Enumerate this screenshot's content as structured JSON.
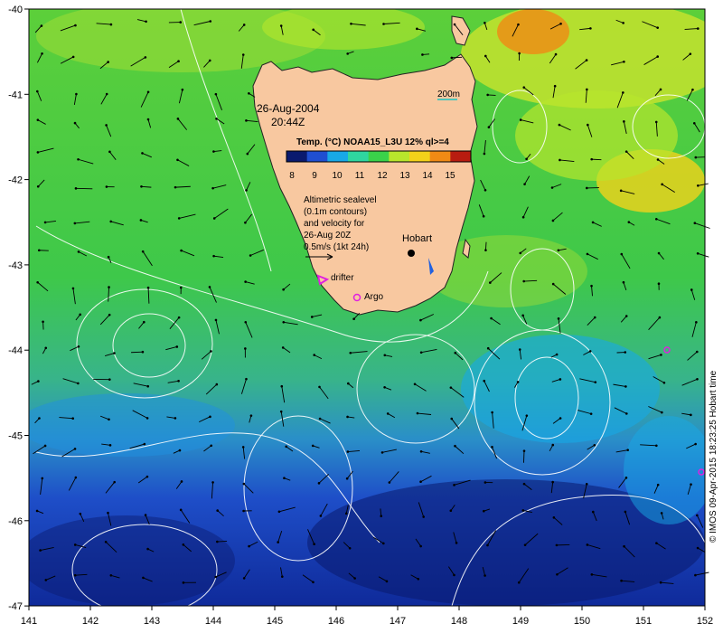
{
  "map": {
    "date": "26-Aug-2004",
    "time": "20:44Z",
    "isobath_label": "200m",
    "colorbar": {
      "title": "Temp. (°C) NOAA15_L3U 12% ql>=4",
      "ticks": [
        "8",
        "9",
        "10",
        "11",
        "12",
        "13",
        "14",
        "15"
      ],
      "colors": [
        "#0a1a6e",
        "#1f4fd1",
        "#18a9e6",
        "#2fd6a0",
        "#3ad24a",
        "#b8e62c",
        "#f3d21a",
        "#f08a14",
        "#b81c10"
      ]
    },
    "legend_lines": [
      "Altimetric sealevel",
      "(0.1m contours)",
      "and velocity for",
      "26-Aug 20Z",
      "0.5m/s (1kt 24h)"
    ],
    "place_labels": {
      "hobart": "Hobart",
      "drifter": "drifter",
      "argo": "Argo"
    },
    "x_ticks": [
      "141",
      "142",
      "143",
      "144",
      "145",
      "146",
      "147",
      "148",
      "149",
      "150",
      "151",
      "152"
    ],
    "y_ticks": [
      "-40",
      "-41",
      "-42",
      "-43",
      "-44",
      "-45",
      "-46",
      "-47"
    ],
    "credit": "© IMOS 09-Apr-2015 18:23:25 Hobart time"
  }
}
